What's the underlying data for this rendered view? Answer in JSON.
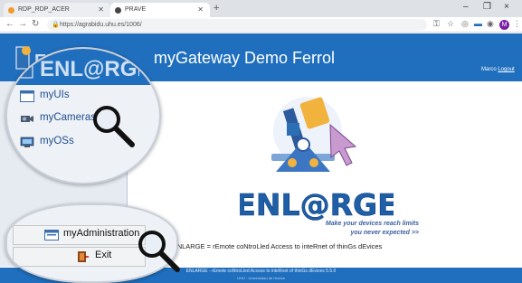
{
  "browser": {
    "tabs": [
      {
        "label": "RDP_RDP_ACER",
        "active": false
      },
      {
        "label": "PRAVE",
        "active": true
      }
    ],
    "url": "https://agrabidu.uhu.es/1006/",
    "window_controls": [
      "–",
      "❐",
      "×"
    ]
  },
  "app": {
    "title": "myGateway Demo Ferrol",
    "user_label": "Marco",
    "logout_label": "Logout",
    "header_color": "#1f6fbe"
  },
  "sidebar": {
    "items": [
      {
        "label": "myUIs",
        "icon": "window-icon"
      },
      {
        "label": "myCameras",
        "icon": "camera-icon"
      },
      {
        "label": "myOSs",
        "icon": "computer-icon"
      }
    ],
    "bottom": [
      {
        "label": "myAdministration",
        "icon": "admin-icon"
      },
      {
        "label": "Exit",
        "icon": "exit-door-icon"
      }
    ]
  },
  "main": {
    "logo_text": "ENL@RGE",
    "tagline_line1": "Make your devices reach limits",
    "tagline_line2": "you never expected >>",
    "acronym": "ENLARGE = rEmote coNtroLled Access to inteRnet of thinGs dEvices"
  },
  "footer": {
    "line1": "ENLARGE - rEmote coNtroLled Access to inteRnet of thinGs dEvices  5.5.0",
    "line2": "UHU - Universidad de Huelva"
  }
}
